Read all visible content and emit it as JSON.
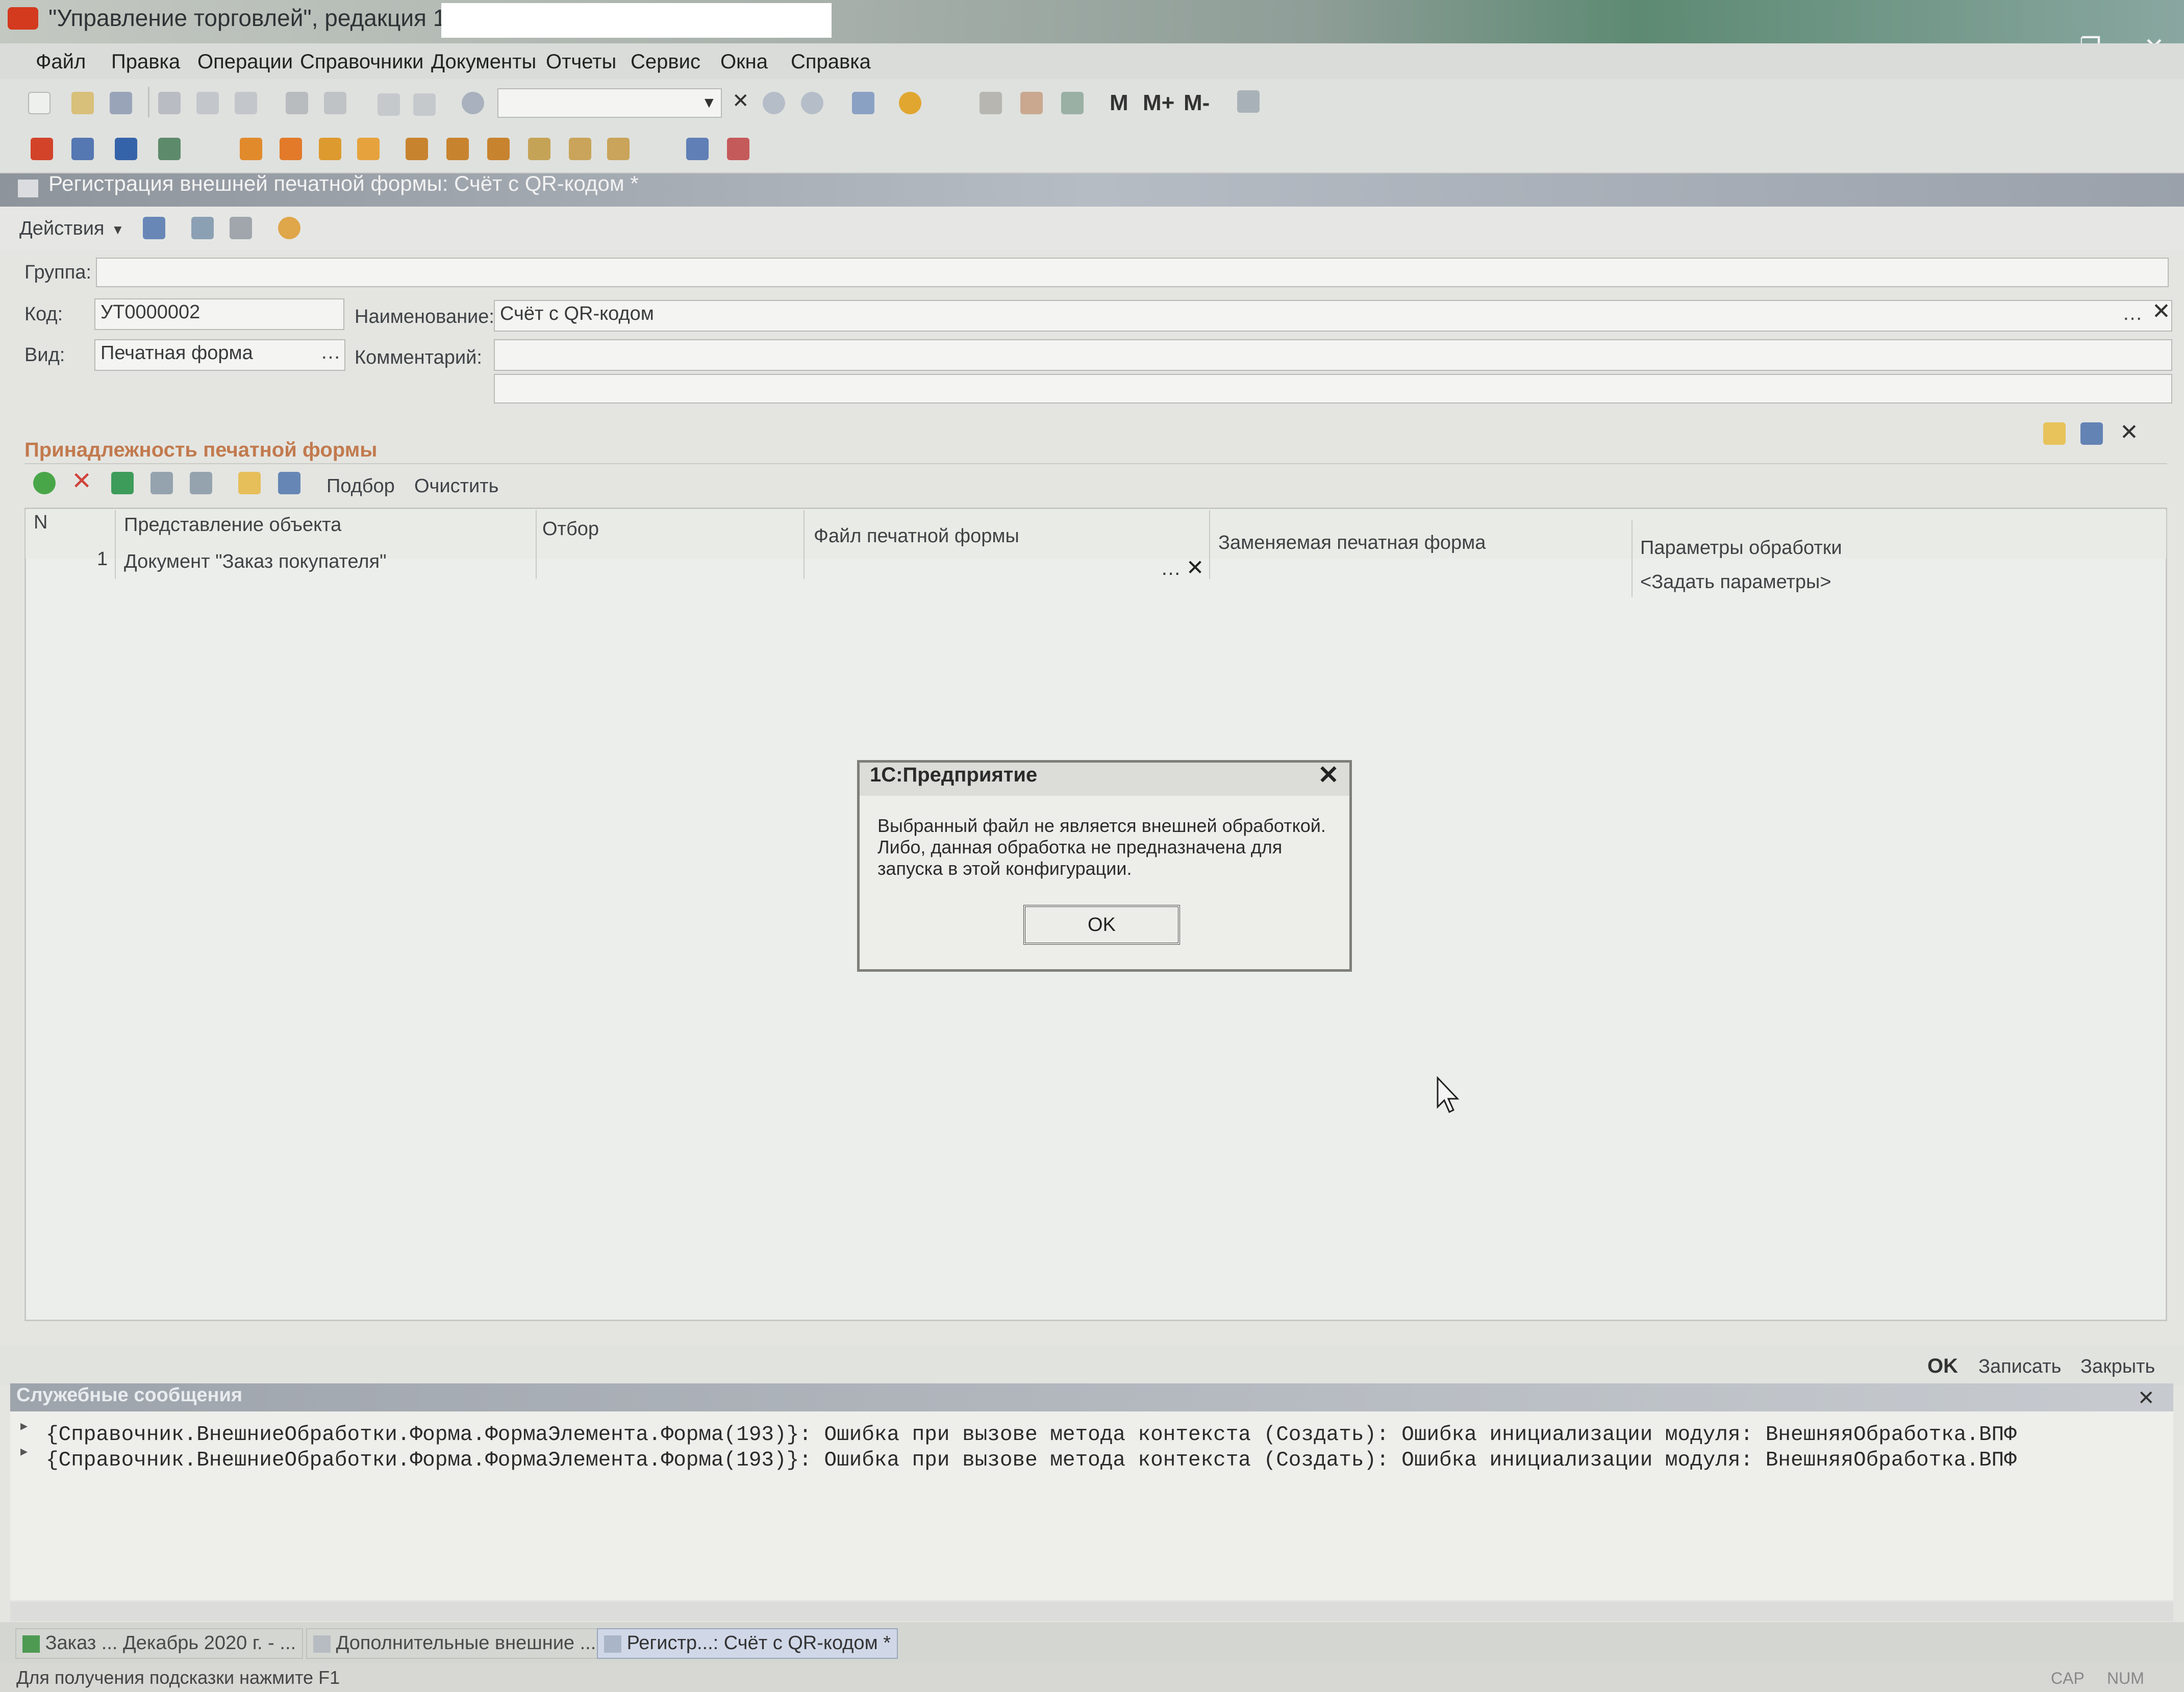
{
  "window": {
    "title": "\"Управление торговлей\", редакция 10.3 /",
    "controls": [
      "–",
      "❐",
      "✕"
    ]
  },
  "menu": [
    "Файл",
    "Правка",
    "Операции",
    "Справочники",
    "Документы",
    "Отчеты",
    "Сервис",
    "Окна",
    "Справка"
  ],
  "toolbar": {
    "memory_buttons": [
      "M",
      "M+",
      "M-"
    ]
  },
  "form": {
    "title": "Регистрация внешней печатной формы: Счёт с QR-кодом *",
    "actions_label": "Действия",
    "group_label": "Группа:",
    "group_value": "",
    "code_label": "Код:",
    "code_value": "УТ0000002",
    "name_label": "Наименование:",
    "name_value": "Счёт с QR-кодом",
    "kind_label": "Вид:",
    "kind_value": "Печатная форма",
    "comment_label": "Комментарий:",
    "comment_value": "",
    "section_title": "Принадлежность печатной формы",
    "tab_buttons": [
      "Подбор",
      "Очистить"
    ],
    "table": {
      "columns": [
        "N",
        "Представление объекта",
        "Отбор",
        "Файл печатной формы",
        "Заменяемая печатная форма",
        "Параметры обработки"
      ],
      "rows": [
        {
          "n": "1",
          "object": "Документ \"Заказ покупателя\"",
          "filter": "",
          "file": "",
          "replaced": "",
          "params": "<Задать параметры>"
        }
      ]
    },
    "buttons": {
      "ok": "OK",
      "save": "Записать",
      "close": "Закрыть"
    }
  },
  "dialog": {
    "title": "1С:Предприятие",
    "message": "Выбранный файл не является внешней обработкой. Либо, данная обработка не предназначена для запуска в этой конфигурации.",
    "ok": "OK"
  },
  "messages": {
    "title": "Служебные сообщения",
    "lines": [
      "{Справочник.ВнешниеОбработки.Форма.ФормаЭлемента.Форма(193)}: Ошибка при вызове метода контекста (Создать): Ошибка инициализации модуля: ВнешняяОбработка.ВПФ",
      "{Справочник.ВнешниеОбработки.Форма.ФормаЭлемента.Форма(193)}: Ошибка при вызове метода контекста (Создать): Ошибка инициализации модуля: ВнешняяОбработка.ВПФ"
    ]
  },
  "taskbar": [
    "Заказ ... Декабрь 2020 г. - ...",
    "Дополнительные внешние ...",
    "Регистр...: Счёт с QR-кодом *"
  ],
  "status": {
    "hint": "Для получения подсказки нажмите F1",
    "cap": "CAP",
    "num": "NUM"
  }
}
